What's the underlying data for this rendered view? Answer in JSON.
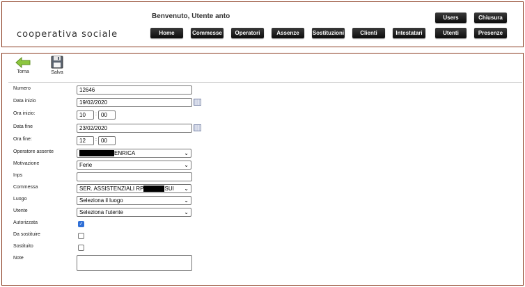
{
  "header": {
    "brand": "cooperativa sociale",
    "welcome": "Benvenuto, Utente anto",
    "top_buttons": [
      "Users",
      "Chiusura"
    ],
    "nav": [
      "Home",
      "Commesse",
      "Operatori",
      "Assenze",
      "Sostituzioni",
      "Clienti",
      "Intestatari",
      "Utenti",
      "Presenze"
    ]
  },
  "toolbar": {
    "back_label": "Torna",
    "save_label": "Salva"
  },
  "form": {
    "numero_label": "Numero",
    "numero_value": "12646",
    "data_inizio_label": "Data inizio",
    "data_inizio_value": "19/02/2020",
    "ora_inizio_label": "Ora inizio:",
    "ora_inizio_h": "10",
    "ora_inizio_m": "00",
    "data_fine_label": "Data fine",
    "data_fine_value": "23/02/2020",
    "ora_fine_label": "Ora fine:",
    "ora_fine_h": "12",
    "ora_fine_m": "00",
    "operatore_label": "Operatore assente",
    "operatore_value": "ENRICA",
    "motivazione_label": "Motivazione",
    "motivazione_value": "Ferie",
    "inps_label": "Inps",
    "inps_value": "",
    "commessa_label": "Commessa",
    "commessa_value_a": "SER. ASSISTENZIALI RP",
    "commessa_value_b": "SUI",
    "luogo_label": "Luogo",
    "luogo_value": "Seleziona il luogo",
    "utente_label": "Utente",
    "utente_value": "Seleziona l'utente",
    "autorizzata_label": "Autorizzata",
    "autorizzata_checked": true,
    "da_sostituire_label": "Da sostituire",
    "da_sostituire_checked": false,
    "sostituito_label": "Sostituito",
    "sostituito_checked": false,
    "note_label": "Note",
    "note_value": "",
    "time_separator": ":"
  }
}
